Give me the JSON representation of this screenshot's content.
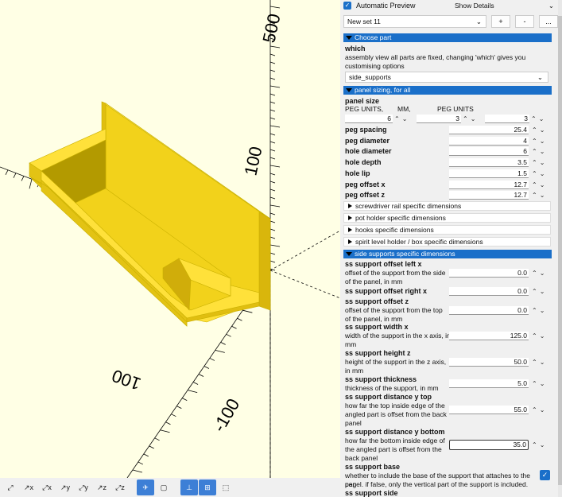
{
  "viewport": {
    "axis_labels": [
      "500",
      "100",
      "100",
      "-100"
    ],
    "toolbar_icons": [
      "zoom-all-icon",
      "view-right-icon",
      "view-top-icon",
      "view-bottom-icon",
      "view-left-icon",
      "view-front-icon",
      "view-back-icon",
      "perspective-icon",
      "orthogonal-icon",
      "show-axes-icon",
      "show-scale-icon",
      "show-edges-icon"
    ],
    "toolbar_glyphs": [
      "⤢",
      "↗x",
      "⤢x",
      "↗y",
      "⤢y",
      "↗z",
      "⤢z",
      "✈",
      "▢",
      "⊥",
      "⊞",
      "⬚"
    ]
  },
  "customizer": {
    "auto_preview_label": "Automatic Preview",
    "auto_preview_check": "✓",
    "details_select": "Show Details",
    "preset_select": "New set 11",
    "btn_add": "+",
    "btn_remove": "-",
    "btn_more": "...",
    "sections": {
      "choose_part": "Choose part",
      "panel_sizing": "panel sizing, for all",
      "side_supports": "side supports specific dimensions"
    },
    "which": {
      "label": "which",
      "desc1": "assembly view all parts are fixed, changing 'which' gives you",
      "desc2": "customising options",
      "value": "side_supports"
    },
    "panel_size": {
      "label": "panel size",
      "col1": "PEG UNITS,",
      "col2": "MM,",
      "col3": "PEG UNITS",
      "v1": "6",
      "v2": "3",
      "v3": "3"
    },
    "params": [
      {
        "label": "peg spacing",
        "value": "25.4"
      },
      {
        "label": "peg diameter",
        "value": "4"
      },
      {
        "label": "hole diameter",
        "value": "6"
      },
      {
        "label": "hole depth",
        "value": "3.5"
      },
      {
        "label": "hole lip",
        "value": "1.5"
      },
      {
        "label": "peg offset x",
        "value": "12.7"
      },
      {
        "label": "peg offset z",
        "value": "12.7"
      }
    ],
    "collapsed": [
      "screwdriver rail specific dimensions",
      "pot holder specific dimensions",
      "hooks specific dimensions",
      "spirit level holder / box specific dimensions"
    ],
    "ss": {
      "left_label": "ss support offset left x",
      "left_d1": "offset of the support from the side",
      "left_d2": "of the panel, in mm",
      "left_value": "0.0",
      "right_label": "ss support offset right x",
      "right_value": "0.0",
      "z_label": "ss support offset z",
      "z_d1": "offset of the support from the top",
      "z_d2": "of the panel, in mm",
      "z_value": "0.0",
      "w_label": "ss support width x",
      "w_d1": "width of the support in the x axis, in",
      "w_d2": "mm",
      "w_value": "125.0",
      "h_label": "ss support height z",
      "h_d1": "height of the support in the z axis,",
      "h_d2": "in mm",
      "h_value": "50.0",
      "t_label": "ss support thickness",
      "t_d1": "thickness of the support, in mm",
      "t_value": "5.0",
      "yt_label": "ss support distance y top",
      "yt_d1": "how far the top inside edge of the",
      "yt_d2": "angled part is offset from the back",
      "yt_d3": "panel",
      "yt_value": "55.0",
      "yb_label": "ss support distance y bottom",
      "yb_d1": "how far the bottom inside edge of",
      "yb_d2": "the angled part is offset from the",
      "yb_d3": "back panel",
      "yb_value": "35.0",
      "base_label": "ss support base",
      "base_d1": "whether to include the base of the support that attaches to the peg",
      "base_d2": "panel. if false, only the vertical part of the support is included.",
      "base_check": "✓",
      "side_label": "ss support side"
    },
    "arrows": "⌃⌄",
    "chevron": "⌄"
  }
}
